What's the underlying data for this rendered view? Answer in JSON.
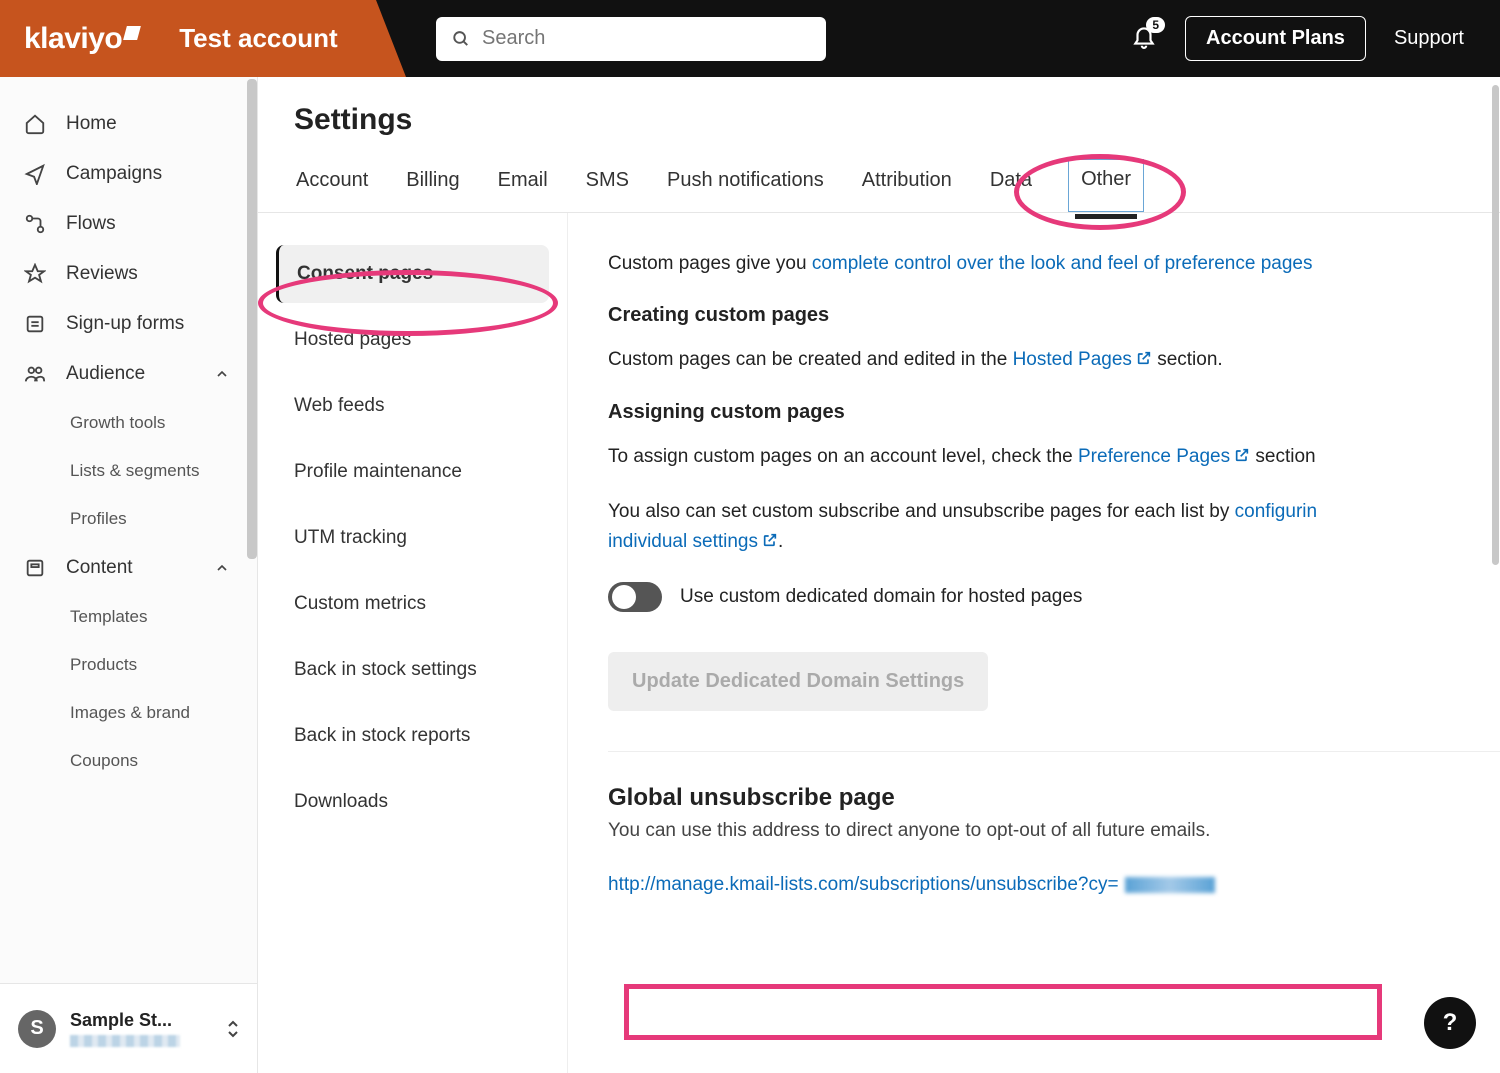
{
  "header": {
    "logo": "klaviyo",
    "account_label": "Test account",
    "search_placeholder": "Search",
    "notification_count": "5",
    "plans_button": "Account Plans",
    "support": "Support"
  },
  "sidebar": {
    "items": [
      {
        "label": "Home",
        "icon": "home"
      },
      {
        "label": "Campaigns",
        "icon": "send"
      },
      {
        "label": "Flows",
        "icon": "flow"
      },
      {
        "label": "Reviews",
        "icon": "star"
      },
      {
        "label": "Sign-up forms",
        "icon": "form"
      },
      {
        "label": "Audience",
        "icon": "audience",
        "expanded": true
      },
      {
        "label": "Content",
        "icon": "content",
        "expanded": true
      }
    ],
    "audience_sub": [
      "Growth tools",
      "Lists & segments",
      "Profiles"
    ],
    "content_sub": [
      "Templates",
      "Products",
      "Images & brand",
      "Coupons"
    ],
    "account": {
      "initial": "S",
      "name": "Sample St..."
    }
  },
  "settings": {
    "title": "Settings",
    "tabs": [
      "Account",
      "Billing",
      "Email",
      "SMS",
      "Push notifications",
      "Attribution",
      "Data",
      "Other"
    ],
    "active_tab": "Other",
    "subnav": [
      "Consent pages",
      "Hosted pages",
      "Web feeds",
      "Profile maintenance",
      "UTM tracking",
      "Custom metrics",
      "Back in stock settings",
      "Back in stock reports",
      "Downloads"
    ],
    "active_sub": "Consent pages"
  },
  "panel": {
    "intro_prefix": "Custom pages give you ",
    "intro_link": "complete control over the look and feel of preference pages",
    "h1": "Creating custom pages",
    "p1_a": "Custom pages can be created and edited in the ",
    "p1_link": "Hosted Pages",
    "p1_b": " section.",
    "h2": "Assigning custom pages",
    "p2_a": "To assign custom pages on an account level, check the ",
    "p2_link": "Preference Pages",
    "p2_b": " section",
    "p3_a": "You also can set custom subscribe and unsubscribe pages for each list by ",
    "p3_link": "configurin",
    "p3_line2": "individual settings",
    "toggle_label": "Use custom dedicated domain for hosted pages",
    "update_btn": "Update Dedicated Domain Settings",
    "unsub_title": "Global unsubscribe page",
    "unsub_desc": "You can use this address to direct anyone to opt-out of all future emails.",
    "unsub_url": "http://manage.kmail-lists.com/subscriptions/unsubscribe?cy="
  },
  "help": "?"
}
